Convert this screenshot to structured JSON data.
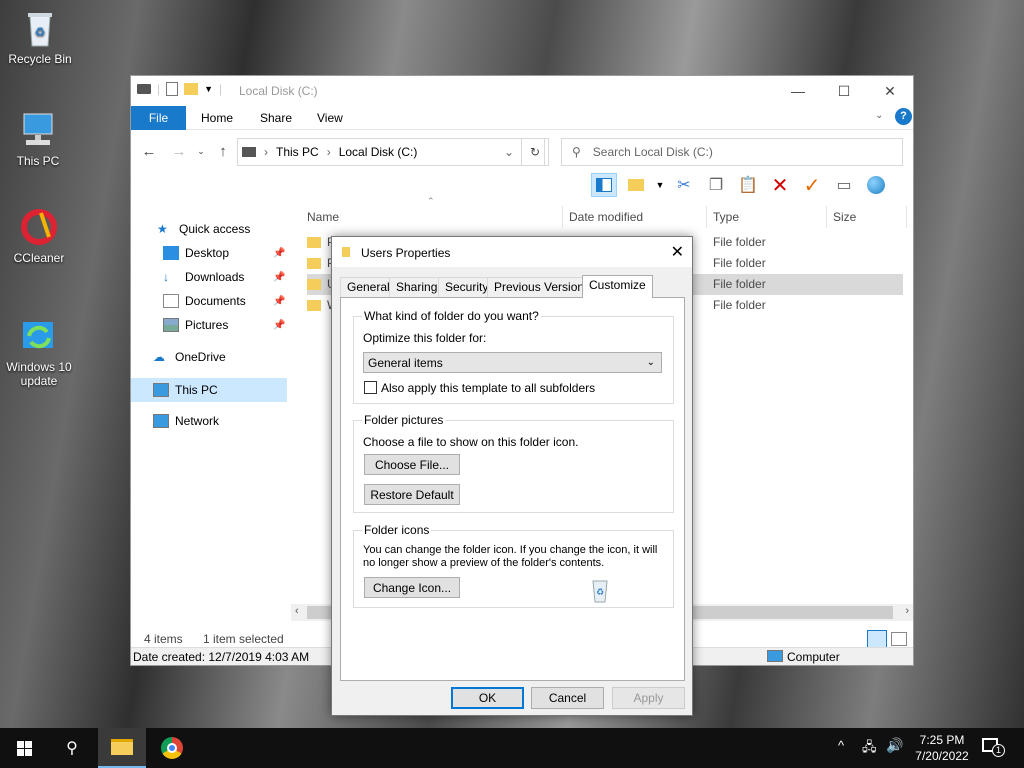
{
  "desktop": {
    "icons": [
      {
        "label": "Recycle Bin"
      },
      {
        "label": "This PC"
      },
      {
        "label": "CCleaner"
      },
      {
        "label": "Windows 10 update"
      }
    ]
  },
  "explorer": {
    "title": "Local Disk (C:)",
    "ribbon_tabs": [
      "File",
      "Home",
      "Share",
      "View"
    ],
    "breadcrumb": [
      "This PC",
      "Local Disk (C:)"
    ],
    "search_placeholder": "Search Local Disk (C:)",
    "nav": {
      "quick_access": "Quick access",
      "desktop": "Desktop",
      "downloads": "Downloads",
      "documents": "Documents",
      "pictures": "Pictures",
      "onedrive": "OneDrive",
      "this_pc": "This PC",
      "network": "Network"
    },
    "columns": {
      "name": "Name",
      "date": "Date modified",
      "type": "Type",
      "size": "Size"
    },
    "rows": [
      {
        "name": "P",
        "type": "File folder"
      },
      {
        "name": "P",
        "type": "File folder"
      },
      {
        "name": "U",
        "type": "File folder"
      },
      {
        "name": "W",
        "type": "File folder"
      }
    ],
    "status": {
      "items": "4 items",
      "selected": "1 item selected"
    },
    "details": {
      "date_created": "Date created: 12/7/2019 4:03 AM",
      "location": "Computer"
    }
  },
  "dialog": {
    "title": "Users Properties",
    "tabs": [
      "General",
      "Sharing",
      "Security",
      "Previous Versions",
      "Customize"
    ],
    "group1": {
      "label": "What kind of folder do you want?",
      "optimize_label": "Optimize this folder for:",
      "selected_option": "General items",
      "checkbox_label": "Also apply this template to all subfolders"
    },
    "group2": {
      "label": "Folder pictures",
      "desc": "Choose a file to show on this folder icon.",
      "choose_btn": "Choose File...",
      "restore_btn": "Restore Default"
    },
    "group3": {
      "label": "Folder icons",
      "desc_line1": "You can change the folder icon. If you change the icon, it will",
      "desc_line2": "no longer show a preview of the folder's contents.",
      "change_btn": "Change Icon..."
    },
    "buttons": {
      "ok": "OK",
      "cancel": "Cancel",
      "apply": "Apply"
    }
  },
  "taskbar": {
    "time": "7:25 PM",
    "date": "7/20/2022",
    "notification_count": "1"
  },
  "colors": {
    "accent": "#1979ca",
    "selection": "#cce8ff",
    "taskbar": "#101010"
  }
}
